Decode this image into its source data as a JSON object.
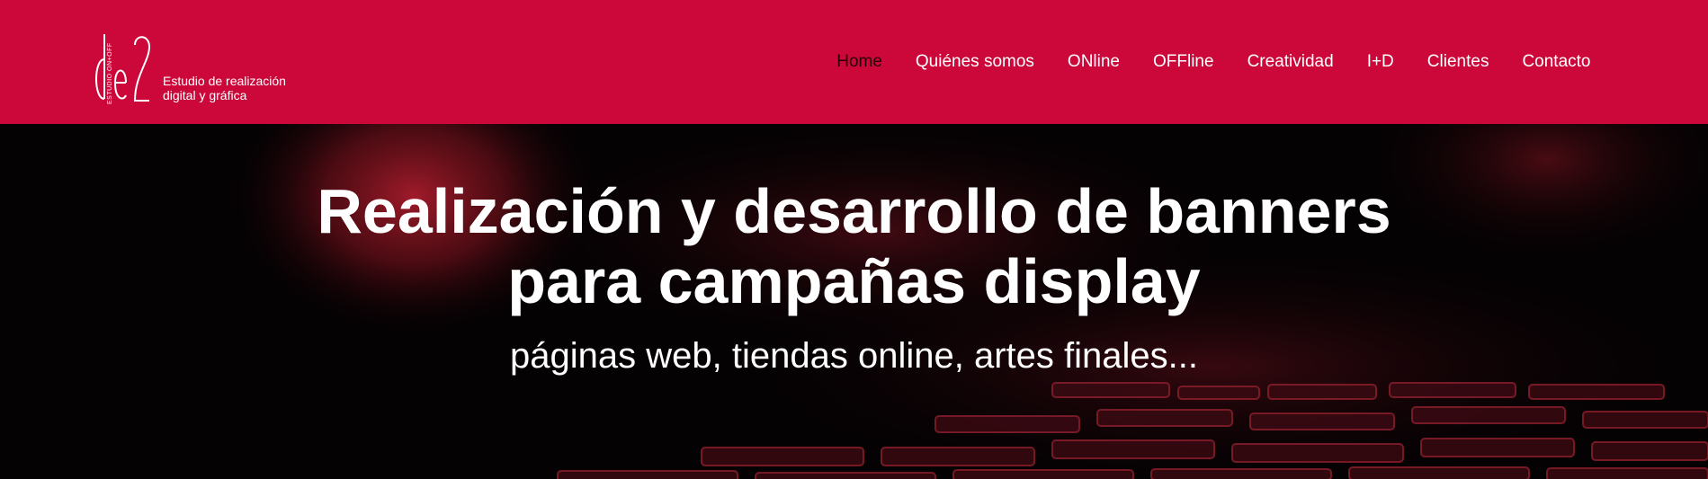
{
  "brand": {
    "logo_letters": "de2",
    "logo_vertical_text": "ESTUDIO ON+OFF",
    "tagline_line1": "Estudio de realización",
    "tagline_line2": "digital y gráfica",
    "header_color": "#cc0739"
  },
  "nav": {
    "items": [
      {
        "label": "Home",
        "active": true
      },
      {
        "label": "Quiénes somos",
        "active": false
      },
      {
        "label": "ONline",
        "active": false
      },
      {
        "label": "OFFline",
        "active": false
      },
      {
        "label": "Creatividad",
        "active": false
      },
      {
        "label": "I+D",
        "active": false
      },
      {
        "label": "Clientes",
        "active": false
      },
      {
        "label": "Contacto",
        "active": false
      }
    ]
  },
  "hero": {
    "title_line1": "Realización y desarrollo de banners",
    "title_line2": "para campañas display",
    "subtitle": "páginas web, tiendas online, artes finales..."
  }
}
